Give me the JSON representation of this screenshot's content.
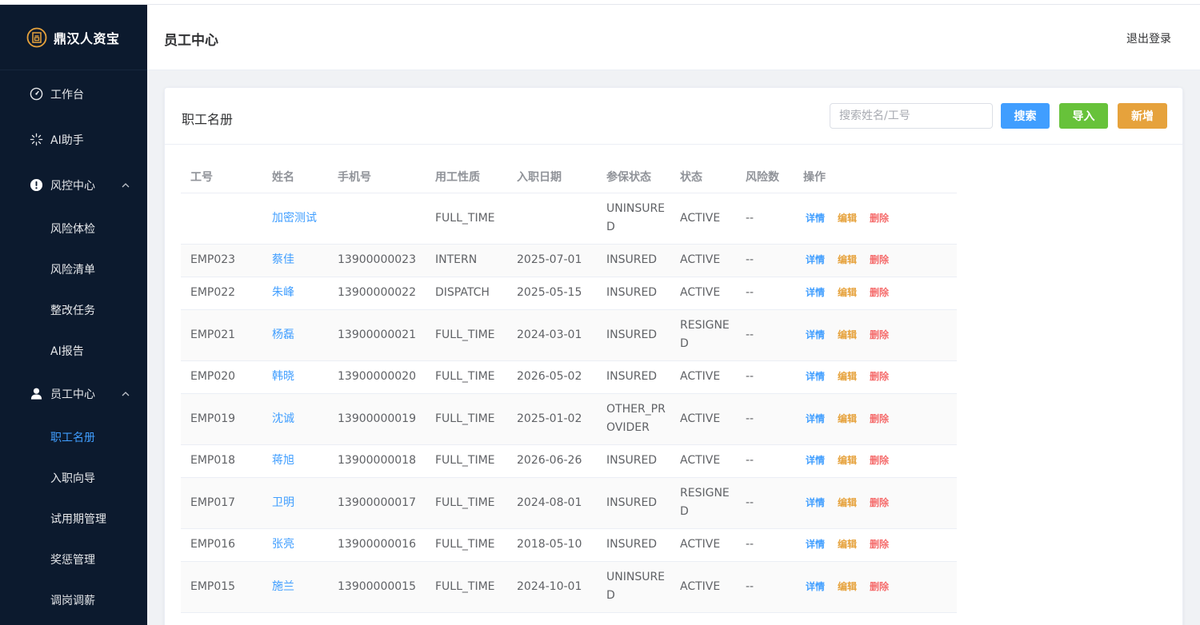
{
  "brand": {
    "name": "鼎汉人资宝",
    "logo_icon": "brand-seal-icon",
    "logo_color": "#e6a23c"
  },
  "sidebar": {
    "items": [
      {
        "label": "工作台",
        "icon": "dashboard-icon"
      },
      {
        "label": "AI助手",
        "icon": "sparkle-icon"
      },
      {
        "label": "风控中心",
        "icon": "alert-circle-icon",
        "expanded": true,
        "children": [
          "风险体检",
          "风险清单",
          "整改任务",
          "AI报告"
        ]
      },
      {
        "label": "员工中心",
        "icon": "user-icon",
        "expanded": true,
        "children": [
          "职工名册",
          "入职向导",
          "试用期管理",
          "奖惩管理",
          "调岗调薪"
        ]
      }
    ],
    "active_child": "职工名册",
    "active_color": "#409eff"
  },
  "header": {
    "title": "员工中心",
    "logout_label": "退出登录"
  },
  "card": {
    "title": "职工名册",
    "search_placeholder": "搜索姓名/工号",
    "search_label": "搜索",
    "import_label": "导入",
    "add_label": "新增"
  },
  "table": {
    "columns": [
      "工号",
      "姓名",
      "手机号",
      "用工性质",
      "入职日期",
      "参保状态",
      "状态",
      "风险数",
      "操作"
    ],
    "actions": {
      "detail": "详情",
      "edit": "编辑",
      "delete": "删除"
    },
    "rows": [
      {
        "id": "",
        "name": "加密测试",
        "phone": "",
        "type": "FULL_TIME",
        "date": "",
        "insurance": "UNINSURED",
        "status": "ACTIVE",
        "risk": "--"
      },
      {
        "id": "EMP023",
        "name": "蔡佳",
        "phone": "13900000023",
        "type": "INTERN",
        "date": "2025-07-01",
        "insurance": "INSURED",
        "status": "ACTIVE",
        "risk": "--"
      },
      {
        "id": "EMP022",
        "name": "朱峰",
        "phone": "13900000022",
        "type": "DISPATCH",
        "date": "2025-05-15",
        "insurance": "INSURED",
        "status": "ACTIVE",
        "risk": "--"
      },
      {
        "id": "EMP021",
        "name": "杨磊",
        "phone": "13900000021",
        "type": "FULL_TIME",
        "date": "2024-03-01",
        "insurance": "INSURED",
        "status": "RESIGNED",
        "risk": "--"
      },
      {
        "id": "EMP020",
        "name": "韩晓",
        "phone": "13900000020",
        "type": "FULL_TIME",
        "date": "2026-05-02",
        "insurance": "INSURED",
        "status": "ACTIVE",
        "risk": "--"
      },
      {
        "id": "EMP019",
        "name": "沈诚",
        "phone": "13900000019",
        "type": "FULL_TIME",
        "date": "2025-01-02",
        "insurance": "OTHER_PROVIDER",
        "status": "ACTIVE",
        "risk": "--"
      },
      {
        "id": "EMP018",
        "name": "蒋旭",
        "phone": "13900000018",
        "type": "FULL_TIME",
        "date": "2026-06-26",
        "insurance": "INSURED",
        "status": "ACTIVE",
        "risk": "--"
      },
      {
        "id": "EMP017",
        "name": "卫明",
        "phone": "13900000017",
        "type": "FULL_TIME",
        "date": "2024-08-01",
        "insurance": "INSURED",
        "status": "RESIGNED",
        "risk": "--"
      },
      {
        "id": "EMP016",
        "name": "张亮",
        "phone": "13900000016",
        "type": "FULL_TIME",
        "date": "2018-05-10",
        "insurance": "INSURED",
        "status": "ACTIVE",
        "risk": "--"
      },
      {
        "id": "EMP015",
        "name": "施兰",
        "phone": "13900000015",
        "type": "FULL_TIME",
        "date": "2024-10-01",
        "insurance": "UNINSURED",
        "status": "ACTIVE",
        "risk": "--"
      }
    ]
  }
}
